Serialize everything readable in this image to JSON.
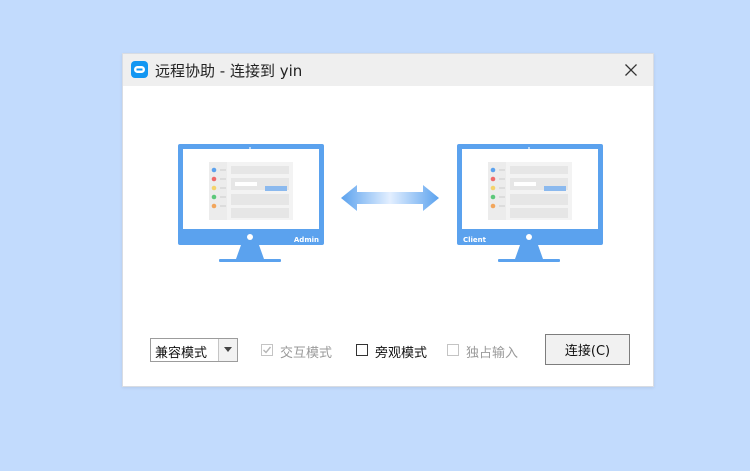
{
  "window": {
    "title": "远程协助 - 连接到 yin"
  },
  "illustration": {
    "left_monitor_label": "Admin",
    "right_monitor_label": "Client"
  },
  "controls": {
    "mode_select_value": "兼容模式",
    "interactive_mode": {
      "label": "交互模式",
      "checked": true,
      "disabled": true
    },
    "view_mode": {
      "label": "旁观模式",
      "checked": false,
      "disabled": false
    },
    "exclusive_input": {
      "label": "独占输入",
      "checked": false,
      "disabled": true
    },
    "connect_button": "连接(C)"
  },
  "colors": {
    "desktop_background": "#c2dbfd",
    "monitor_blue": "#5ba2ee",
    "app_icon_blue": "#1296f2"
  },
  "icons": [
    "app-icon",
    "close-icon",
    "chevron-down-icon",
    "double-arrow-icon",
    "check-icon"
  ]
}
